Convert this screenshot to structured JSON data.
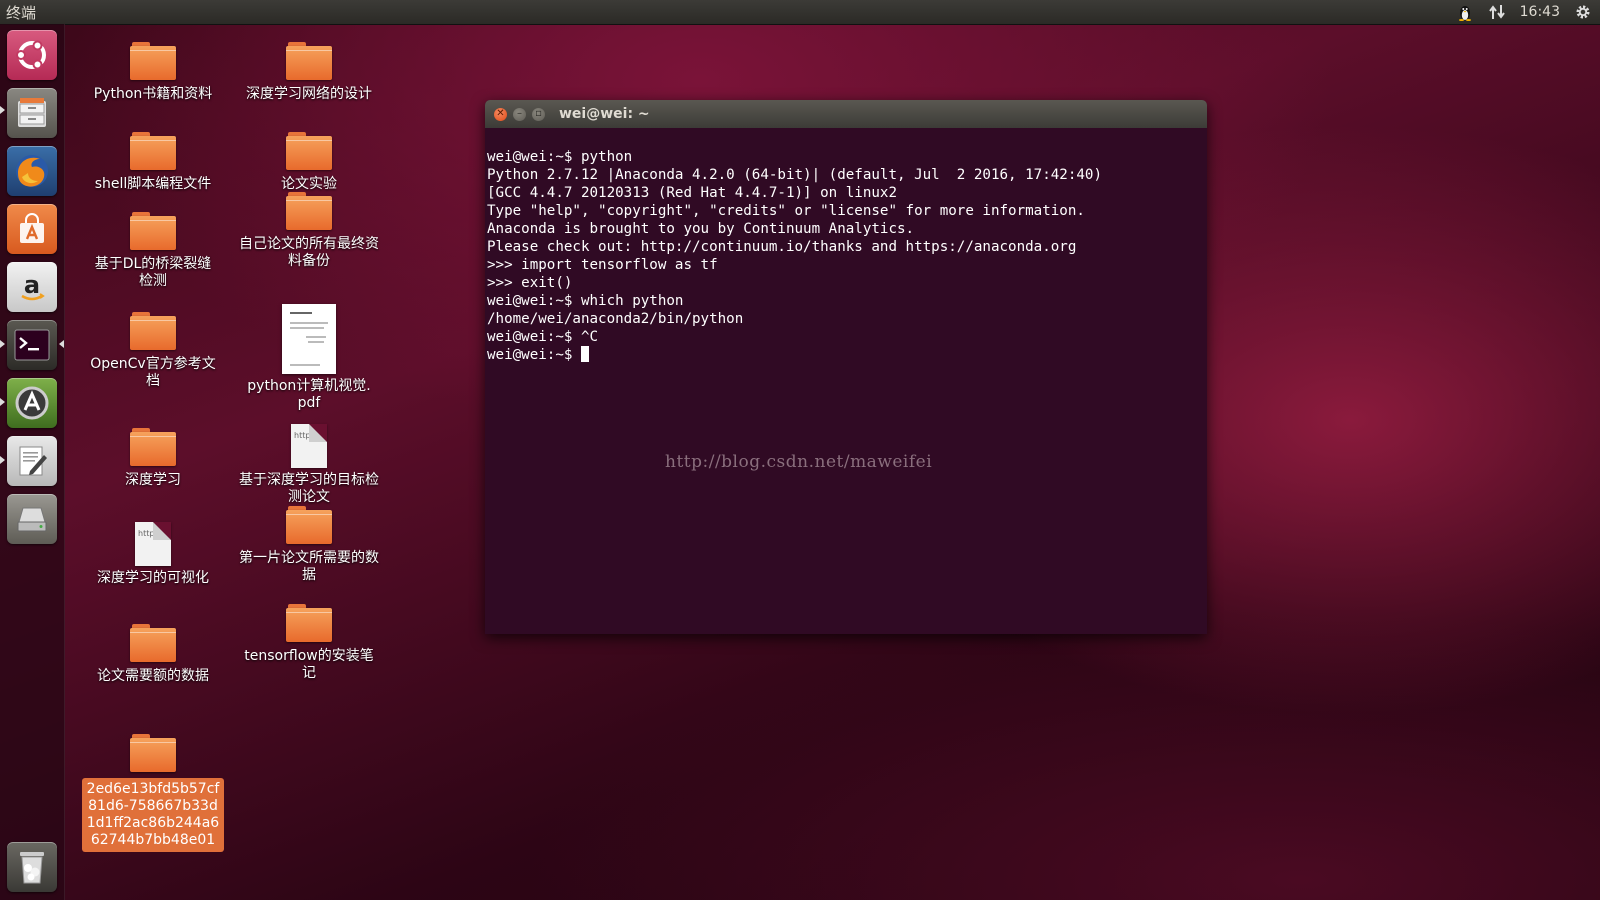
{
  "panel": {
    "title": "终端",
    "time": "16:43"
  },
  "launcher": {
    "items": [
      {
        "name": "dash-button"
      },
      {
        "name": "files"
      },
      {
        "name": "firefox"
      },
      {
        "name": "software-center"
      },
      {
        "name": "amazon"
      },
      {
        "name": "terminal"
      },
      {
        "name": "software-updater"
      },
      {
        "name": "text-editor"
      },
      {
        "name": "disk"
      },
      {
        "name": "trash"
      }
    ]
  },
  "desktop": {
    "col1": [
      {
        "label": "Python书籍和资料",
        "type": "folder"
      },
      {
        "label": "shell脚本编程文件",
        "type": "folder"
      },
      {
        "label": "基于DL的桥梁裂缝检测",
        "type": "folder"
      },
      {
        "label": "OpenCv官方参考文档",
        "type": "folder"
      },
      {
        "label": "深度学习",
        "type": "folder"
      },
      {
        "label": "深度学习的可视化",
        "type": "file",
        "glyph": "http://"
      },
      {
        "label": "论文需要额的数据",
        "type": "folder"
      },
      {
        "label": "2ed6e13bfd5b57cf81d6-758667b33d1d1ff2ac86b244a662744b7bb48e01",
        "type": "folder",
        "selected": true
      }
    ],
    "col2": [
      {
        "label": "深度学习网络的设计",
        "type": "folder"
      },
      {
        "label": "论文实验",
        "type": "folder"
      },
      {
        "label": "自己论文的所有最终资料备份",
        "type": "folder"
      },
      {
        "label": "python计算机视觉.pdf",
        "type": "pdf"
      },
      {
        "label": "基于深度学习的目标检测论文",
        "type": "file",
        "glyph": "https:"
      },
      {
        "label": "第一片论文所需要的数据",
        "type": "folder"
      },
      {
        "label": "tensorflow的安装笔记",
        "type": "folder"
      }
    ]
  },
  "terminal": {
    "title": "wei@wei: ~",
    "lines": [
      "wei@wei:~$ python",
      "Python 2.7.12 |Anaconda 4.2.0 (64-bit)| (default, Jul  2 2016, 17:42:40)",
      "[GCC 4.4.7 20120313 (Red Hat 4.4.7-1)] on linux2",
      "Type \"help\", \"copyright\", \"credits\" or \"license\" for more information.",
      "Anaconda is brought to you by Continuum Analytics.",
      "Please check out: http://continuum.io/thanks and https://anaconda.org",
      ">>> import tensorflow as tf",
      ">>> exit()",
      "wei@wei:~$ which python",
      "/home/wei/anaconda2/bin/python",
      "wei@wei:~$ ^C"
    ],
    "prompt": "wei@wei:~$ "
  },
  "watermark": "http://blog.csdn.net/maweifei"
}
